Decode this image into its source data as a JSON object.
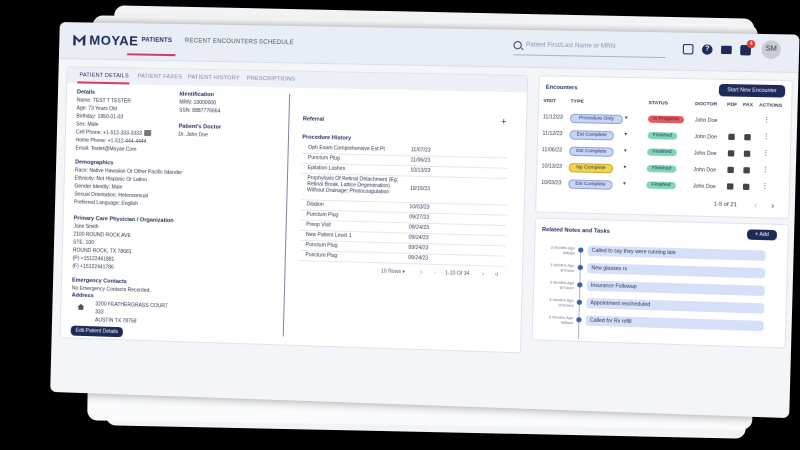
{
  "app": {
    "logo": "MOYAE"
  },
  "nav": {
    "patients": "PATIENTS",
    "recent_encounters": "RECENT ENCOUNTERS",
    "schedule": "SCHEDULE"
  },
  "search": {
    "placeholder": "Patient First/Last Name or MRN"
  },
  "header": {
    "notification_count": "4",
    "avatar_initials": "SM"
  },
  "subtabs": [
    "PATIENT DETAILS",
    "PATIENT FAXES",
    "PATIENT HISTORY",
    "PRESCRIPTIONS"
  ],
  "details": {
    "title": "Details",
    "lines": [
      "Name: TEST T TESTER",
      "Age: 73 Years Old",
      "Birthday: 1950-01-03",
      "Sex: Male",
      "Cell Phone: +1-512-333-3333",
      "Home Phone: +1-512-444-4444",
      "Email: Tester@Moyae.Com"
    ]
  },
  "identification": {
    "title": "Identification",
    "lines": [
      "MRN: 10000000",
      "SSN: 8887776664"
    ]
  },
  "patients_doctor": {
    "title": "Patient's Doctor",
    "name": "Dr. John Doe"
  },
  "demographics": {
    "title": "Demographics",
    "lines": [
      "Race: Native Hawaiian Or Other Pacific Islander",
      "Ethnicity: Not Hispanic Or Latino",
      "Gender Identity: Male",
      "Sexual Orientation: Heterosexual",
      "Preferred Language: English"
    ]
  },
  "pcp": {
    "title": "Primary Care Physician / Organization",
    "lines": [
      "Jane Smith",
      "2100 ROUND ROCK AVE",
      "STE. 100",
      "ROUND ROCK, TX 78681",
      "(P) +15122441881",
      "(F) +15122441786"
    ]
  },
  "emergency": {
    "title": "Emergency Contacts",
    "value": "No Emergency Contacts Recorded."
  },
  "address": {
    "title": "Address",
    "lines": [
      "3200 FEATHERGRASS COURT",
      "333",
      "AUSTIN TX 78758"
    ]
  },
  "edit_button": "Edit Patient Details",
  "referral": {
    "title": "Referral",
    "add": "+"
  },
  "procedure_history": {
    "title": "Procedure History",
    "rows": [
      {
        "name": "Oph Exam Comprehensive Est Pt",
        "date": "11/07/23"
      },
      {
        "name": "Punctum Plug",
        "date": "11/06/23"
      },
      {
        "name": "Epilation Lashes",
        "date": "10/13/23"
      },
      {
        "name": "Prophylaxis Of Retinal Detachment (Eg, Retinal Break, Lattice Degeneration) Without Drainage; Photocoagulation",
        "date": "10/15/23"
      },
      {
        "name": "Dilation",
        "date": "10/03/23"
      },
      {
        "name": "Punctum Plug",
        "date": "09/27/23"
      },
      {
        "name": "Preop Visit",
        "date": "09/24/23"
      },
      {
        "name": "New Patient Level 1",
        "date": "09/24/23"
      },
      {
        "name": "Punctum Plug",
        "date": "09/24/23"
      },
      {
        "name": "Punctum Plug",
        "date": "09/24/23"
      }
    ],
    "rows_per_page": "10 Rows",
    "range": "1-10 Of 34"
  },
  "encounters": {
    "title": "Encounters",
    "start_button": "Start New Encounter",
    "columns": [
      "VISIT",
      "TYPE",
      "STATUS",
      "DOCTOR",
      "PDF",
      "FAX",
      "ACTIONS"
    ],
    "rows": [
      {
        "visit": "11/12/23",
        "type": "Procedure Only",
        "status": "In Progress",
        "doctor": "John Doe"
      },
      {
        "visit": "11/12/23",
        "type": "Est Complete",
        "status": "Finished",
        "doctor": "John Doe"
      },
      {
        "visit": "11/06/23",
        "type": "Est Complete",
        "status": "Finished",
        "doctor": "John Doe"
      },
      {
        "visit": "10/13/23",
        "type": "Np Complete",
        "status": "Finished",
        "doctor": "John Doe"
      },
      {
        "visit": "10/03/23",
        "type": "Est Complete",
        "status": "Finished",
        "doctor": "John Doe"
      }
    ],
    "pagination": "1-5 of 21"
  },
  "notes": {
    "title": "Related Notes and Tasks",
    "add_button": "Add",
    "items": [
      {
        "date": "3 Months Ago Wflash",
        "text": "Called to say they were running late"
      },
      {
        "date": "3 Months Ago BTraver",
        "text": "New glasses rx"
      },
      {
        "date": "3 Months Ago BTraver",
        "text": "Insurance Followup"
      },
      {
        "date": "3 Months Ago DOmara",
        "text": "Appointment rescheduled"
      },
      {
        "date": "3 Months Ago Wflash",
        "text": "Called for Rx refill"
      }
    ]
  },
  "colors": {
    "brand": "#1e2a5a",
    "accent": "#d23c6c",
    "in_progress": "#e8595c",
    "finished": "#7fd6b4",
    "type_blue": "#c9d5f5",
    "type_yellow": "#f3d34a"
  }
}
